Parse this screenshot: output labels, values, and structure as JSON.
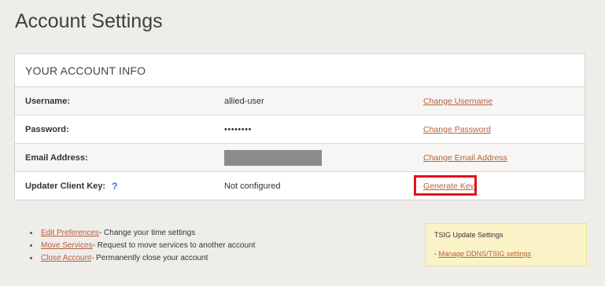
{
  "page": {
    "title": "Account Settings"
  },
  "account_info": {
    "header": "YOUR ACCOUNT INFO",
    "rows": [
      {
        "label": "Username:",
        "value": "allied-user",
        "action": "Change Username"
      },
      {
        "label": "Password:",
        "value": "••••••••",
        "action": "Change Password"
      },
      {
        "label": "Email Address:",
        "value": "",
        "action": "Change Email Address"
      },
      {
        "label": "Updater Client Key:",
        "help_icon": "?",
        "value": "Not configured",
        "action": "Generate Key"
      }
    ]
  },
  "bottom_links": [
    {
      "link": "Edit Preferences",
      "description": " - Change your time settings"
    },
    {
      "link": "Move Services",
      "description": " - Request to move services to another account"
    },
    {
      "link": "Close Account",
      "description": " - Permanently close your account"
    }
  ],
  "tsig": {
    "title": "TSIG Update Settings",
    "prefix": "- ",
    "link": "Manage DDNS/TSIG settings"
  },
  "colors": {
    "link": "#b5603c",
    "highlight": "#e1141c",
    "help_icon": "#2f78c4",
    "tsig_background": "#fbf3c8"
  },
  "icons": {
    "help": "help-icon"
  }
}
